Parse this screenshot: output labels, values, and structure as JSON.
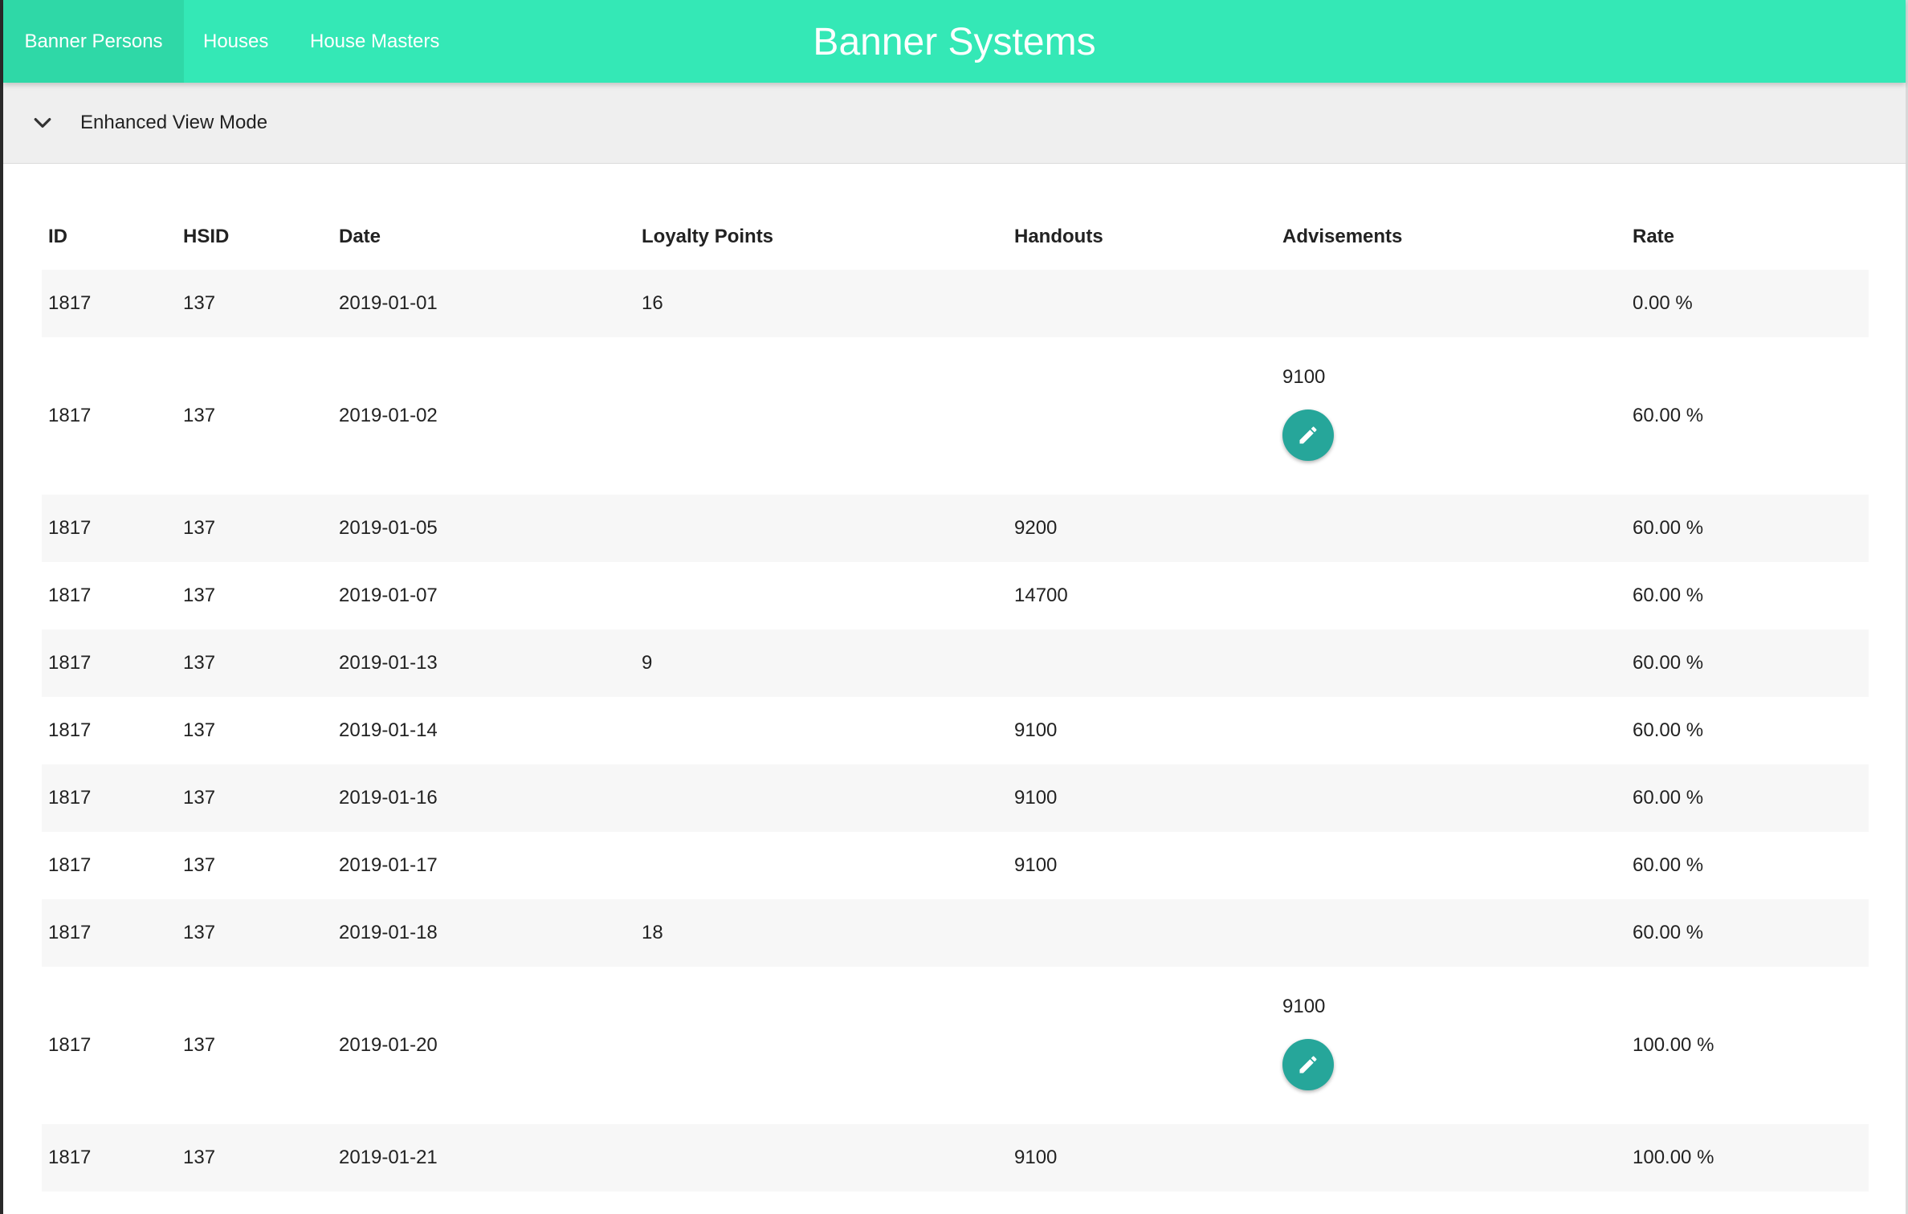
{
  "app": {
    "title": "Banner Systems",
    "accent_color": "#34e8b6",
    "action_color": "#26a69a"
  },
  "nav": {
    "tabs": [
      {
        "label": "Banner Persons",
        "active": true
      },
      {
        "label": "Houses",
        "active": false
      },
      {
        "label": "House Masters",
        "active": false
      }
    ]
  },
  "panel": {
    "label": "Enhanced View Mode",
    "icon": "chevron-down-icon"
  },
  "table": {
    "headers": [
      "ID",
      "HSID",
      "Date",
      "Loyalty Points",
      "Handouts",
      "Advisements",
      "Rate"
    ],
    "rows": [
      {
        "id": "1817",
        "hsid": "137",
        "date": "2019-01-01",
        "loyalty_points": "16",
        "handouts": "",
        "advisements": "",
        "rate": "0.00 %",
        "editable": false
      },
      {
        "id": "1817",
        "hsid": "137",
        "date": "2019-01-02",
        "loyalty_points": "",
        "handouts": "",
        "advisements": "9100",
        "rate": "60.00 %",
        "editable": true
      },
      {
        "id": "1817",
        "hsid": "137",
        "date": "2019-01-05",
        "loyalty_points": "",
        "handouts": "9200",
        "advisements": "",
        "rate": "60.00 %",
        "editable": false
      },
      {
        "id": "1817",
        "hsid": "137",
        "date": "2019-01-07",
        "loyalty_points": "",
        "handouts": "14700",
        "advisements": "",
        "rate": "60.00 %",
        "editable": false
      },
      {
        "id": "1817",
        "hsid": "137",
        "date": "2019-01-13",
        "loyalty_points": "9",
        "handouts": "",
        "advisements": "",
        "rate": "60.00 %",
        "editable": false
      },
      {
        "id": "1817",
        "hsid": "137",
        "date": "2019-01-14",
        "loyalty_points": "",
        "handouts": "9100",
        "advisements": "",
        "rate": "60.00 %",
        "editable": false
      },
      {
        "id": "1817",
        "hsid": "137",
        "date": "2019-01-16",
        "loyalty_points": "",
        "handouts": "9100",
        "advisements": "",
        "rate": "60.00 %",
        "editable": false
      },
      {
        "id": "1817",
        "hsid": "137",
        "date": "2019-01-17",
        "loyalty_points": "",
        "handouts": "9100",
        "advisements": "",
        "rate": "60.00 %",
        "editable": false
      },
      {
        "id": "1817",
        "hsid": "137",
        "date": "2019-01-18",
        "loyalty_points": "18",
        "handouts": "",
        "advisements": "",
        "rate": "60.00 %",
        "editable": false
      },
      {
        "id": "1817",
        "hsid": "137",
        "date": "2019-01-20",
        "loyalty_points": "",
        "handouts": "",
        "advisements": "9100",
        "rate": "100.00 %",
        "editable": true
      },
      {
        "id": "1817",
        "hsid": "137",
        "date": "2019-01-21",
        "loyalty_points": "",
        "handouts": "9100",
        "advisements": "",
        "rate": "100.00 %",
        "editable": false
      }
    ]
  }
}
